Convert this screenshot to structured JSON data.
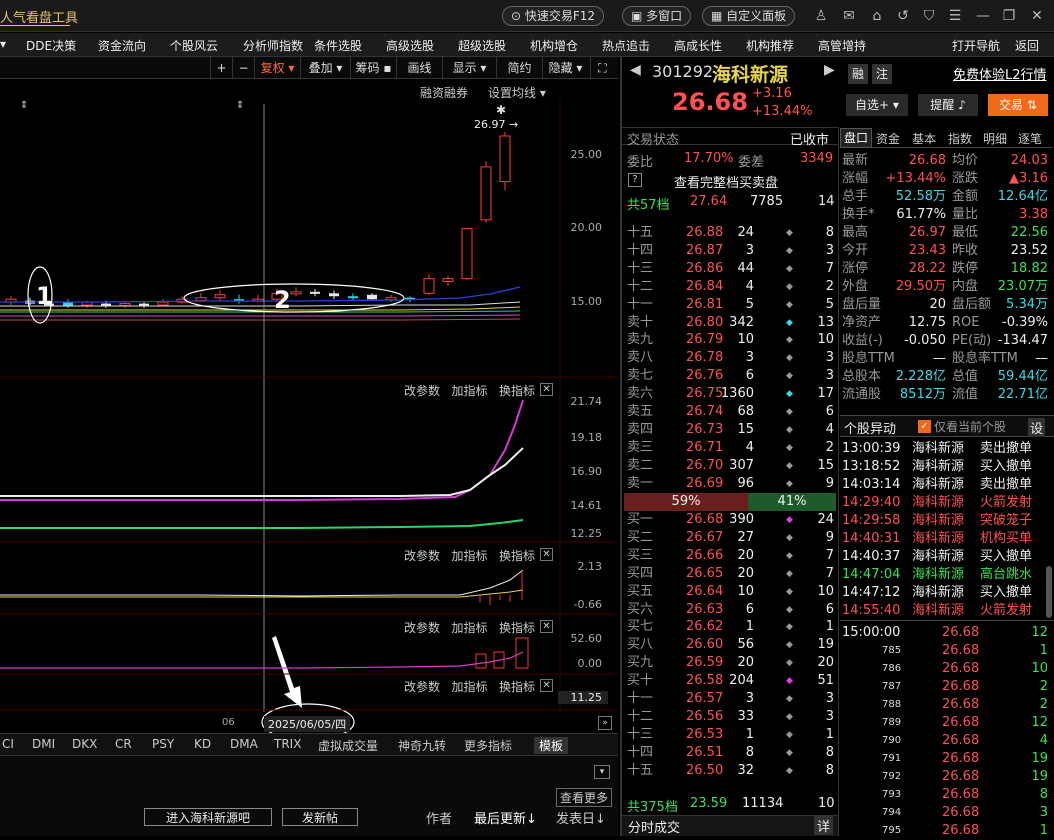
{
  "app": {
    "brand": "人气看盘工具",
    "quick_trade": "快速交易F12",
    "multi_window": "多窗口",
    "custom_panel": "自定义面板"
  },
  "menu": [
    "DDE决策",
    "资金流向",
    "个股风云",
    "分析师指数",
    "条件选股",
    "高级选股",
    "超级选股",
    "机构增仓",
    "热点追击",
    "高成长性",
    "机构推荐",
    "高管增持",
    "打开导航",
    "返回"
  ],
  "toolbar": [
    "+",
    "−",
    "复权",
    "叠加",
    "筹码",
    "画线",
    "显示",
    "简约",
    "隐藏"
  ],
  "chart": {
    "header_links": [
      "融资融券",
      "设置均线"
    ],
    "price_label": "26.97",
    "y_main": [
      "25.00",
      "20.00",
      "15.00"
    ],
    "y_p2": [
      "21.74",
      "19.18",
      "16.90",
      "14.61",
      "12.25"
    ],
    "y_p3": [
      "2.13",
      "-0.66"
    ],
    "y_p4": [
      "52.60",
      "0.00"
    ],
    "y_p5": [
      "11.25"
    ],
    "panel_actions": [
      "改参数",
      "加指标",
      "换指标"
    ],
    "annot1": "1",
    "annot2": "2",
    "date_label": "2025/06/05/四",
    "date_prefix": "06",
    "candles": [
      {
        "o": 15.4,
        "c": 15.6,
        "h": 15.8,
        "l": 15.2,
        "up": true
      },
      {
        "o": 15.5,
        "c": 15.3,
        "h": 15.7,
        "l": 15.2,
        "up": false
      },
      {
        "o": 15.3,
        "c": 15.3,
        "h": 15.5,
        "l": 15.1,
        "up": false
      },
      {
        "o": 15.4,
        "c": 15.1,
        "h": 15.6,
        "l": 15.0,
        "up": false
      },
      {
        "o": 15.2,
        "c": 15.4,
        "h": 15.5,
        "l": 15.0,
        "up": true
      },
      {
        "o": 15.3,
        "c": 15.2,
        "h": 15.5,
        "l": 15.0,
        "up": false
      },
      {
        "o": 15.2,
        "c": 15.3,
        "h": 15.4,
        "l": 15.0,
        "up": true
      },
      {
        "o": 15.3,
        "c": 15.1,
        "h": 15.4,
        "l": 15.0,
        "up": false
      },
      {
        "o": 15.2,
        "c": 15.4,
        "h": 15.6,
        "l": 15.1,
        "up": true
      },
      {
        "o": 15.4,
        "c": 15.6,
        "h": 15.8,
        "l": 15.3,
        "up": true
      },
      {
        "o": 15.5,
        "c": 15.7,
        "h": 16.0,
        "l": 15.4,
        "up": true
      },
      {
        "o": 15.7,
        "c": 15.9,
        "h": 16.2,
        "l": 15.5,
        "up": true
      },
      {
        "o": 15.6,
        "c": 15.5,
        "h": 15.9,
        "l": 15.3,
        "up": false
      },
      {
        "o": 15.5,
        "c": 15.6,
        "h": 15.9,
        "l": 15.4,
        "up": true
      },
      {
        "o": 15.6,
        "c": 16.0,
        "h": 16.3,
        "l": 15.5,
        "up": true
      },
      {
        "o": 16.0,
        "c": 16.1,
        "h": 16.4,
        "l": 15.8,
        "up": true
      },
      {
        "o": 16.1,
        "c": 16.0,
        "h": 16.3,
        "l": 15.8,
        "up": false
      },
      {
        "o": 16.0,
        "c": 15.8,
        "h": 16.2,
        "l": 15.6,
        "up": false
      },
      {
        "o": 15.8,
        "c": 15.7,
        "h": 16.0,
        "l": 15.5,
        "up": false
      },
      {
        "o": 15.9,
        "c": 15.6,
        "h": 16.0,
        "l": 15.5,
        "up": false
      },
      {
        "o": 15.6,
        "c": 15.7,
        "h": 15.9,
        "l": 15.4,
        "up": true
      },
      {
        "o": 15.7,
        "c": 15.6,
        "h": 15.8,
        "l": 15.4,
        "up": false
      },
      {
        "o": 16.0,
        "c": 17.0,
        "h": 17.3,
        "l": 15.9,
        "up": true
      },
      {
        "o": 16.8,
        "c": 17.0,
        "h": 17.2,
        "l": 16.5,
        "up": true
      },
      {
        "o": 17.0,
        "c": 20.4,
        "h": 20.4,
        "l": 16.9,
        "up": true
      },
      {
        "o": 21.0,
        "c": 24.6,
        "h": 25.0,
        "l": 20.8,
        "up": true
      },
      {
        "o": 23.6,
        "c": 26.7,
        "h": 26.97,
        "l": 23.0,
        "up": true
      }
    ]
  },
  "indicators": [
    "CI",
    "DMI",
    "DKX",
    "CR",
    "PSY",
    "KD",
    "DMA",
    "TRIX",
    "虚拟成交量",
    "神奇九转",
    "更多指标",
    "模板"
  ],
  "bottom": {
    "more": "查看更多",
    "enter_bar": "进入海科新源吧",
    "post": "发新帖",
    "author": "作者",
    "last_update": "最后更新↓",
    "post_date": "发表日↓"
  },
  "stock": {
    "code": "301292",
    "name": "海科新源",
    "price": "26.68",
    "change": "+3.16",
    "pct": "+13.44%",
    "rong": "融",
    "zhu": "注",
    "l2": "免费体验L2行情",
    "zixuan": "自选+",
    "tixing": "提醒",
    "jiaoyi": "交易"
  },
  "status": {
    "label": "交易状态",
    "value": "已收市",
    "weibi_l": "委比",
    "weibi_v": "17.70%",
    "weicha_l": "委差",
    "weicha_v": "3349",
    "full": "查看完整档买卖盘",
    "gong57_l": "共57档",
    "gong57_p": "27.64",
    "gong57_v": "7785",
    "gong57_n": "14"
  },
  "sells": [
    [
      "十五",
      "26.88",
      "24",
      "8"
    ],
    [
      "十四",
      "26.87",
      "3",
      "3"
    ],
    [
      "十三",
      "26.86",
      "44",
      "7"
    ],
    [
      "十二",
      "26.84",
      "4",
      "2"
    ],
    [
      "十一",
      "26.81",
      "5",
      "5"
    ],
    [
      "卖十",
      "26.80",
      "342",
      "13"
    ],
    [
      "卖九",
      "26.79",
      "10",
      "10"
    ],
    [
      "卖八",
      "26.78",
      "3",
      "3"
    ],
    [
      "卖七",
      "26.76",
      "6",
      "3"
    ],
    [
      "卖六",
      "26.75",
      "1360",
      "17"
    ],
    [
      "卖五",
      "26.74",
      "68",
      "6"
    ],
    [
      "卖四",
      "26.73",
      "15",
      "4"
    ],
    [
      "卖三",
      "26.71",
      "4",
      "2"
    ],
    [
      "卖二",
      "26.70",
      "307",
      "15"
    ],
    [
      "卖一",
      "26.69",
      "96",
      "9"
    ]
  ],
  "ratio": {
    "buy": "59%",
    "sell": "41%"
  },
  "buys": [
    [
      "买一",
      "26.68",
      "390",
      "24"
    ],
    [
      "买二",
      "26.67",
      "27",
      "9"
    ],
    [
      "买三",
      "26.66",
      "20",
      "7"
    ],
    [
      "买四",
      "26.65",
      "20",
      "7"
    ],
    [
      "买五",
      "26.64",
      "10",
      "10"
    ],
    [
      "买六",
      "26.63",
      "6",
      "6"
    ],
    [
      "买七",
      "26.62",
      "1",
      "1"
    ],
    [
      "买八",
      "26.60",
      "56",
      "19"
    ],
    [
      "买九",
      "26.59",
      "20",
      "20"
    ],
    [
      "买十",
      "26.58",
      "204",
      "51"
    ],
    [
      "十一",
      "26.57",
      "3",
      "3"
    ],
    [
      "十二",
      "26.56",
      "33",
      "3"
    ],
    [
      "十三",
      "26.53",
      "1",
      "1"
    ],
    [
      "十四",
      "26.51",
      "8",
      "8"
    ],
    [
      "十五",
      "26.50",
      "32",
      "8"
    ]
  ],
  "gong375": {
    "l": "共375档",
    "p": "23.59",
    "v": "11134",
    "n": "10"
  },
  "fenshi": "分时成交",
  "xiang": "详",
  "rtabs": [
    "盘口",
    "资金",
    "基本",
    "指数",
    "明细",
    "逐笔"
  ],
  "quote": [
    [
      "最新",
      "26.68",
      "均价",
      "24.03"
    ],
    [
      "涨幅",
      "+13.44%",
      "涨跌",
      "▲3.16"
    ],
    [
      "总手",
      "52.58万",
      "金额",
      "12.64亿"
    ],
    [
      "换手*",
      "61.77%",
      "量比",
      "3.38"
    ],
    [
      "最高",
      "26.97",
      "最低",
      "22.56"
    ],
    [
      "今开",
      "23.43",
      "昨收",
      "23.52"
    ],
    [
      "涨停",
      "28.22",
      "跌停",
      "18.82"
    ],
    [
      "外盘",
      "29.50万",
      "内盘",
      "23.07万"
    ],
    [
      "盘后量",
      "20",
      "盘后额",
      "5.34万"
    ],
    [
      "净资产",
      "12.75",
      "ROE",
      "-0.39%"
    ],
    [
      "收益(-)",
      "-0.050",
      "PE(动)",
      "-134.47"
    ],
    [
      "股息TTM",
      "—",
      "股息率TTM",
      "—"
    ],
    [
      "总股本",
      "2.228亿",
      "总值",
      "59.44亿"
    ],
    [
      "流通股",
      "8512万",
      "流值",
      "22.71亿"
    ]
  ],
  "yidong": {
    "title": "个股异动",
    "only": "仅看当前个股",
    "set": "设"
  },
  "events": [
    [
      "13:00:39",
      "海科新源",
      "卖出撤单",
      "w"
    ],
    [
      "13:18:52",
      "海科新源",
      "买入撤单",
      "w"
    ],
    [
      "14:03:14",
      "海科新源",
      "卖出撤单",
      "w"
    ],
    [
      "14:29:40",
      "海科新源",
      "火箭发射",
      "r"
    ],
    [
      "14:29:58",
      "海科新源",
      "突破笼子",
      "r"
    ],
    [
      "14:40:31",
      "海科新源",
      "机构买单",
      "r"
    ],
    [
      "14:40:37",
      "海科新源",
      "买入撤单",
      "w"
    ],
    [
      "14:47:04",
      "海科新源",
      "高台跳水",
      "g"
    ],
    [
      "14:47:12",
      "海科新源",
      "买入撤单",
      "w"
    ],
    [
      "14:55:40",
      "海科新源",
      "火箭发射",
      "r"
    ]
  ],
  "ticks": [
    [
      "15:00:00",
      "26.68",
      "12"
    ],
    [
      "785",
      "26.68",
      "1"
    ],
    [
      "786",
      "26.68",
      "10"
    ],
    [
      "787",
      "26.68",
      "2"
    ],
    [
      "788",
      "26.68",
      "2"
    ],
    [
      "789",
      "26.68",
      "12"
    ],
    [
      "790",
      "26.68",
      "4"
    ],
    [
      "791",
      "26.68",
      "19"
    ],
    [
      "792",
      "26.68",
      "19"
    ],
    [
      "793",
      "26.68",
      "8"
    ],
    [
      "794",
      "26.68",
      "3"
    ],
    [
      "795",
      "26.68",
      "1"
    ]
  ]
}
